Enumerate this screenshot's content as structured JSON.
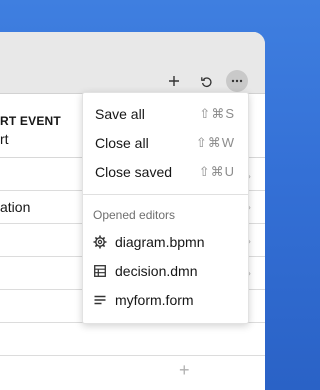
{
  "editor": {
    "column_title": "RT EVENT",
    "column_sub": "rt",
    "rows": [
      "",
      "ation",
      "",
      "",
      ""
    ],
    "add_symbol": "+"
  },
  "toolbar": {
    "icons": [
      "plus-icon",
      "undo-icon",
      "more-icon"
    ]
  },
  "menu": {
    "items": [
      {
        "label": "Save all",
        "shortcut": "⇧⌘S"
      },
      {
        "label": "Close all",
        "shortcut": "⇧⌘W"
      },
      {
        "label": "Close saved",
        "shortcut": "⇧⌘U"
      }
    ],
    "section_title": "Opened editors",
    "editors": [
      {
        "label": "diagram.bpmn",
        "icon": "gear-icon"
      },
      {
        "label": "decision.dmn",
        "icon": "table-icon"
      },
      {
        "label": "myform.form",
        "icon": "form-icon"
      }
    ]
  },
  "colors": {
    "background": "#3470d6",
    "window": "#f4f4f4",
    "titlebar": "#e8e8e8",
    "text": "#161616",
    "muted": "#8d8d8d"
  }
}
